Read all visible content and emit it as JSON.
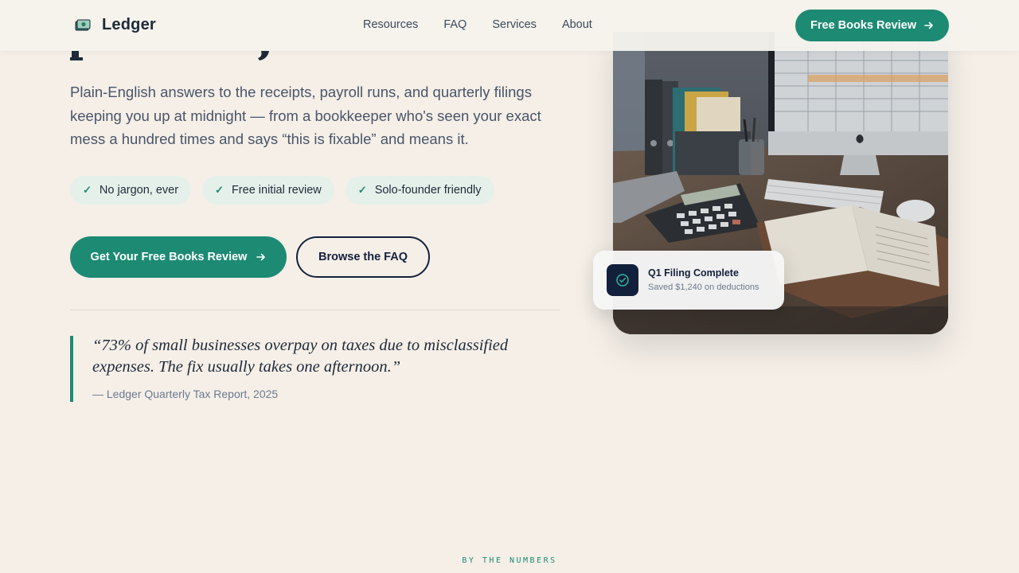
{
  "header": {
    "brand": "Ledger",
    "nav": [
      "Resources",
      "FAQ",
      "Services",
      "About"
    ],
    "cta_label": "Free Books Review"
  },
  "hero": {
    "subtitle": "Plain-English answers to the receipts, payroll runs, and quarterly filings keeping you up at midnight — from a bookkeeper who's seen your exact mess a hundred times and says “this is fixable” and means it.",
    "chips": [
      "No jargon, ever",
      "Free initial review",
      "Solo-founder friendly"
    ],
    "primary_cta": "Get Your Free Books Review",
    "secondary_cta": "Browse the FAQ",
    "quote": "“73% of small businesses overpay on taxes due to misclassified expenses. The fix usually takes one afternoon.”",
    "quote_source": "— Ledger Quarterly Tax Report, 2025"
  },
  "toast": {
    "title": "Q1 Filing Complete",
    "subtitle": "Saved $1,240 on deductions"
  },
  "numbers_section": {
    "label": "BY THE NUMBERS"
  },
  "colors": {
    "accent": "#1d8a74",
    "navy": "#14213d",
    "background": "#f5efe8",
    "chip_bg": "#e6f0ea"
  },
  "icons": {
    "brand": "ledger-money-icon",
    "cta_arrow": "arrow-right-icon",
    "chip_check": "check-icon",
    "toast": "check-circle-icon"
  }
}
